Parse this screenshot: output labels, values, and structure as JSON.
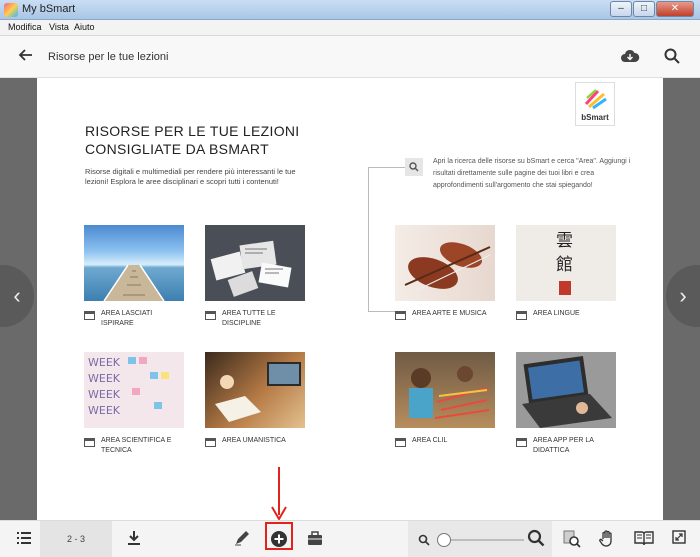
{
  "window": {
    "title": "My bSmart",
    "controls": [
      "–",
      "□",
      "✕"
    ]
  },
  "menu": {
    "items": [
      "Modifica",
      "Vista",
      "Aiuto"
    ]
  },
  "header": {
    "title": "Risorse per le tue lezioni",
    "back_icon": "arrow-left-icon",
    "cloud_icon": "cloud-download-icon",
    "search_icon": "search-icon"
  },
  "page": {
    "logo_text": "bSmart",
    "heading_line1": "RISORSE PER LE TUE LEZIONI",
    "heading_line2": "CONSIGLIATE DA BSMART",
    "intro": "Risorse digitali e multimediali per rendere più interessanti le tue lezioni! Esplora le aree disciplinari e scopri tutti i contenuti!",
    "search_hint": "Apri la ricerca delle risorse su bSmart e cerca \"Area\". Aggiungi i risultati direttamente sulle pagine dei tuoi libri e crea approfondimenti sull'argomento che stai spiegando!",
    "tiles": [
      {
        "label": "AREA LASCIATI ISPIRARE"
      },
      {
        "label": "AREA TUTTE LE DISCIPLINE"
      },
      {
        "label": "AREA ARTE E MUSICA"
      },
      {
        "label": "AREA LINGUE"
      },
      {
        "label": "AREA SCIENTIFICA E TECNICA"
      },
      {
        "label": "AREA UMANISTICA"
      },
      {
        "label": "AREA CLIL"
      },
      {
        "label": "AREA APP PER LA DIDATTICA"
      }
    ],
    "calligraphy": "雲館"
  },
  "nav": {
    "prev": "‹",
    "next": "›"
  },
  "toolbar": {
    "page_indicator": "2 - 3",
    "icons": [
      "list-icon",
      "download-icon",
      "pencil-icon",
      "add-circle-icon",
      "briefcase-icon",
      "zoom-out-icon",
      "zoom-in-icon",
      "search-page-icon",
      "hand-icon",
      "book-icon",
      "fullscreen-icon"
    ],
    "zoom_level": 0
  },
  "colors": {
    "highlight": "#e2231a",
    "background": "#6a6a6a",
    "page": "#ffffff"
  }
}
